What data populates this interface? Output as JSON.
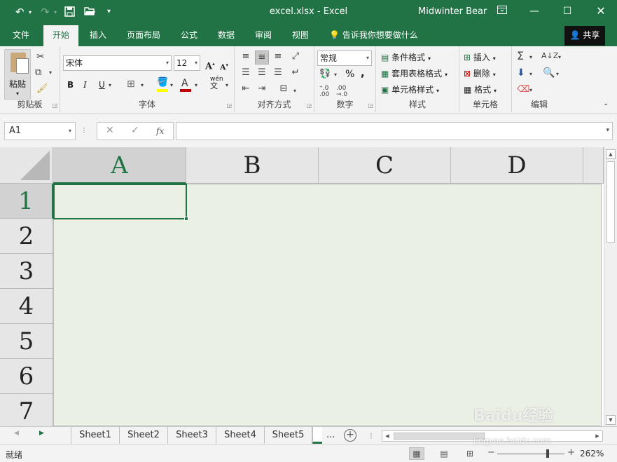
{
  "titlebar": {
    "title": "excel.xlsx  -  Excel",
    "user": "Midwinter Bear",
    "undo_icon": "undo-icon",
    "redo_icon": "redo-icon",
    "save_icon": "save-icon",
    "open_icon": "open-folder-icon",
    "customize_icon": "customize-quick-access-icon"
  },
  "tabs": {
    "items": [
      "文件",
      "开始",
      "插入",
      "页面布局",
      "公式",
      "数据",
      "审阅",
      "视图"
    ],
    "active": "开始",
    "tellme": "告诉我你想要做什么",
    "share": "共享"
  },
  "ribbon": {
    "clipboard": {
      "label": "剪贴板",
      "paste": "粘贴"
    },
    "font": {
      "label": "字体",
      "name": "宋体",
      "size": "12",
      "bold": "B",
      "italic": "I",
      "underline": "U",
      "grow": "A",
      "shrink": "A",
      "phonetic": "wén",
      "phonetic_sub": "文",
      "highlight_color": "#ffff00",
      "font_color": "#c00000"
    },
    "alignment": {
      "label": "对齐方式"
    },
    "number": {
      "label": "数字",
      "format": "常规",
      "percent": "%",
      "comma": ","
    },
    "styles": {
      "label": "样式",
      "conditional": "条件格式",
      "table": "套用表格格式",
      "cell": "单元格样式"
    },
    "cells": {
      "label": "单元格",
      "insert": "插入",
      "delete": "删除",
      "format": "格式"
    },
    "editing": {
      "label": "编辑"
    }
  },
  "formula_bar": {
    "name_box": "A1",
    "fx": "fx",
    "value": ""
  },
  "grid": {
    "columns": [
      "A",
      "B",
      "C",
      "D"
    ],
    "rows": [
      "1",
      "2",
      "3",
      "4",
      "5",
      "6",
      "7"
    ],
    "active_cell": "A1"
  },
  "sheets": {
    "tabs": [
      "Sheet1",
      "Sheet2",
      "Sheet3",
      "Sheet4",
      "Sheet5"
    ],
    "more": "..."
  },
  "status": {
    "text": "就绪",
    "zoom": "262%"
  },
  "watermark": {
    "brand": "Baidu经验",
    "url": "jingyan.baidu.com"
  },
  "colors": {
    "accent": "#217346",
    "cell_bg": "#ebf0e4",
    "ribbon_bg": "#f3f3f3"
  }
}
